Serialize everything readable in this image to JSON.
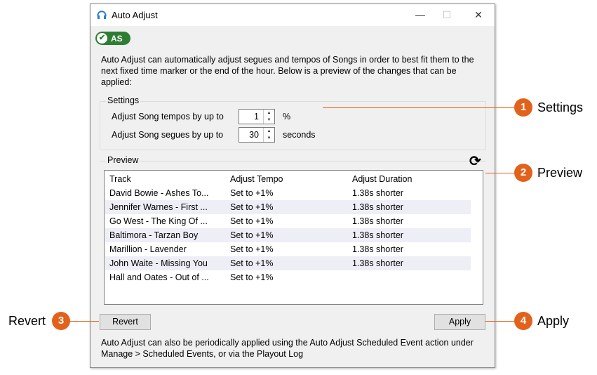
{
  "window": {
    "title": "Auto Adjust",
    "minimize": "—",
    "maximize": "☐",
    "close": "✕"
  },
  "badge": {
    "label": "AS",
    "icon": "check-circle-icon",
    "color": "#2e7d32"
  },
  "intro": "Auto Adjust can automatically adjust segues and tempos of Songs in order to best fit them to the next fixed time marker or the end of the hour. Below is a preview of the changes that can be applied:",
  "settings": {
    "title": "Settings",
    "tempo_label": "Adjust Song tempos by up to",
    "tempo_value": "1",
    "tempo_unit": "%",
    "segue_label": "Adjust Song segues by up to",
    "segue_value": "30",
    "segue_unit": "seconds"
  },
  "preview": {
    "title": "Preview",
    "refresh_icon": "refresh-icon",
    "columns": [
      "Track",
      "Adjust Tempo",
      "Adjust Duration"
    ],
    "rows": [
      {
        "track": "David Bowie - Ashes To...",
        "tempo": "Set to +1%",
        "duration": "1.38s shorter"
      },
      {
        "track": "Jennifer Warnes - First ...",
        "tempo": "Set to +1%",
        "duration": "1.38s shorter"
      },
      {
        "track": "Go West - The King Of ...",
        "tempo": "Set to +1%",
        "duration": "1.38s shorter"
      },
      {
        "track": "Baltimora - Tarzan Boy",
        "tempo": "Set to +1%",
        "duration": "1.38s shorter"
      },
      {
        "track": "Marillion - Lavender",
        "tempo": "Set to +1%",
        "duration": "1.38s shorter"
      },
      {
        "track": "John Waite - Missing You",
        "tempo": "Set to +1%",
        "duration": "1.38s shorter"
      },
      {
        "track": "Hall and Oates - Out of ...",
        "tempo": "Set to +1%",
        "duration": ""
      }
    ]
  },
  "buttons": {
    "revert": "Revert",
    "apply": "Apply"
  },
  "footer": "Auto Adjust can also be periodically applied using the Auto Adjust Scheduled Event action under Manage > Scheduled Events, or via the Playout Log",
  "callouts": [
    {
      "n": "1",
      "label": "Settings"
    },
    {
      "n": "2",
      "label": "Preview"
    },
    {
      "n": "3",
      "label": "Revert"
    },
    {
      "n": "4",
      "label": "Apply"
    }
  ],
  "accent": "#e2621b"
}
